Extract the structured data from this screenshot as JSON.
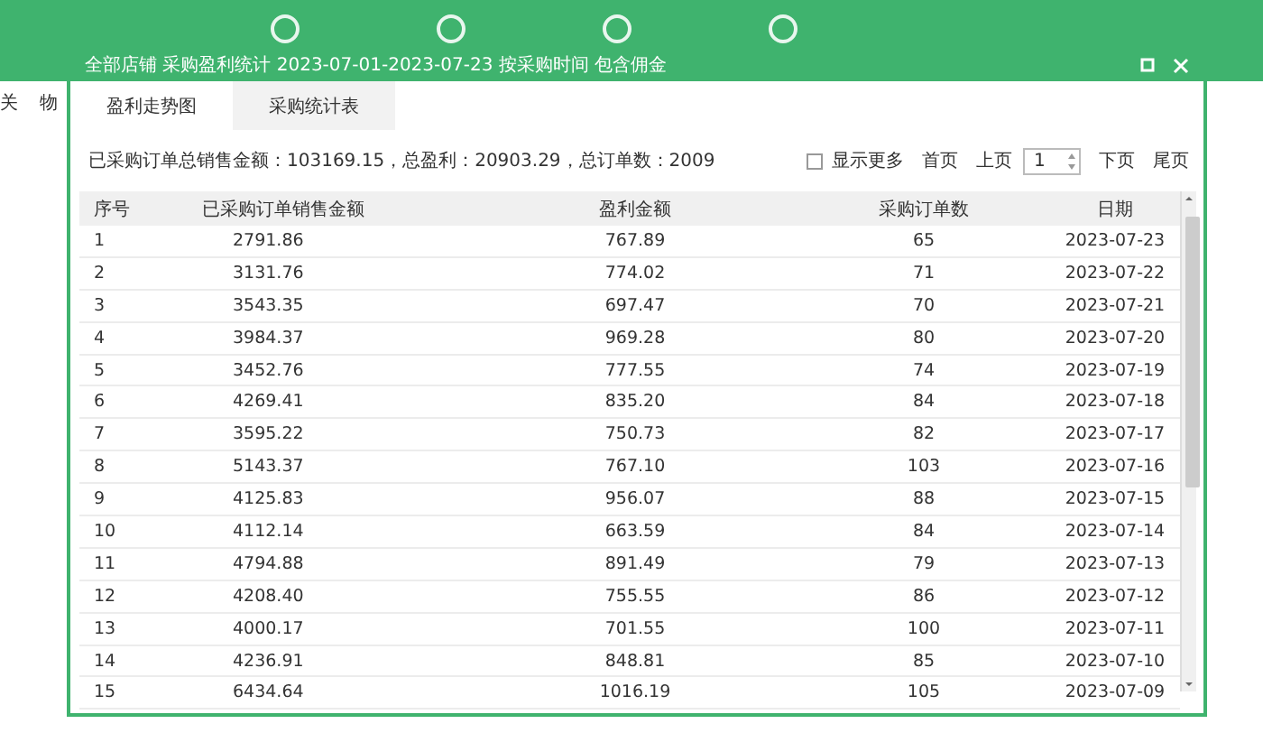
{
  "background": {
    "side_menu": [
      "关",
      "物"
    ]
  },
  "dialog": {
    "title": "全部店铺 采购盈利统计 2023-07-01-2023-07-23 按采购时间 包含佣金",
    "tabs": [
      {
        "label": "盈利走势图",
        "selected": false
      },
      {
        "label": "采购统计表",
        "selected": true
      }
    ],
    "summary": "已采购订单总销售金额：103169.15，总盈利：20903.29，总订单数：2009",
    "show_more": {
      "label": "显示更多",
      "checked": false
    },
    "pager": {
      "first": "首页",
      "prev": "上页",
      "page": "1",
      "next": "下页",
      "last": "尾页"
    },
    "table": {
      "columns": [
        "序号",
        "已采购订单销售金额",
        "盈利金额",
        "采购订单数",
        "日期"
      ],
      "rows": [
        [
          "1",
          "2791.86",
          "767.89",
          "65",
          "2023-07-23"
        ],
        [
          "2",
          "3131.76",
          "774.02",
          "71",
          "2023-07-22"
        ],
        [
          "3",
          "3543.35",
          "697.47",
          "70",
          "2023-07-21"
        ],
        [
          "4",
          "3984.37",
          "969.28",
          "80",
          "2023-07-20"
        ],
        [
          "5",
          "3452.76",
          "777.55",
          "74",
          "2023-07-19"
        ],
        [
          "6",
          "4269.41",
          "835.20",
          "84",
          "2023-07-18"
        ],
        [
          "7",
          "3595.22",
          "750.73",
          "82",
          "2023-07-17"
        ],
        [
          "8",
          "5143.37",
          "767.10",
          "103",
          "2023-07-16"
        ],
        [
          "9",
          "4125.83",
          "956.07",
          "88",
          "2023-07-15"
        ],
        [
          "10",
          "4112.14",
          "663.59",
          "84",
          "2023-07-14"
        ],
        [
          "11",
          "4794.88",
          "891.49",
          "79",
          "2023-07-13"
        ],
        [
          "12",
          "4208.40",
          "755.55",
          "86",
          "2023-07-12"
        ],
        [
          "13",
          "4000.17",
          "701.55",
          "100",
          "2023-07-11"
        ],
        [
          "14",
          "4236.91",
          "848.81",
          "85",
          "2023-07-10"
        ],
        [
          "15",
          "6434.64",
          "1016.19",
          "105",
          "2023-07-09"
        ]
      ]
    }
  }
}
